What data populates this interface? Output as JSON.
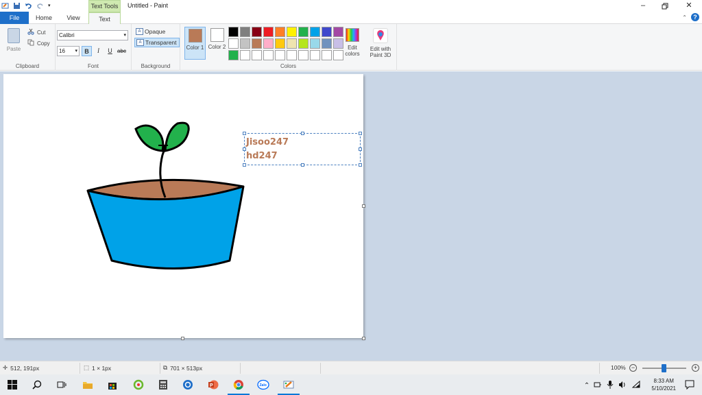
{
  "window": {
    "title": "Untitled - Paint",
    "context_tab": "Text Tools",
    "controls": [
      "minimize-icon",
      "restore-icon",
      "close-icon"
    ]
  },
  "tabs": [
    {
      "label": "File"
    },
    {
      "label": "Home"
    },
    {
      "label": "View"
    },
    {
      "label": "Text"
    }
  ],
  "ribbon": {
    "clipboard": {
      "label": "Clipboard",
      "paste": "Paste",
      "cut": "Cut",
      "copy": "Copy"
    },
    "font": {
      "label": "Font",
      "family": "Calibri",
      "size": "16",
      "bold": "B",
      "italic": "I",
      "underline": "U",
      "strikethrough": "abc"
    },
    "background": {
      "label": "Background",
      "opaque": "Opaque",
      "transparent": "Transparent"
    },
    "colors": {
      "label": "Colors",
      "color1": "Color 1",
      "color2": "Color 2",
      "color1_value": "#b97a57",
      "color2_value": "#ffffff",
      "palette": [
        "#000000",
        "#7f7f7f",
        "#880015",
        "#ed1c24",
        "#ff7f27",
        "#fff200",
        "#22b14c",
        "#00a2e8",
        "#3f48cc",
        "#a349a4",
        "#ffffff",
        "#c3c3c3",
        "#b97a57",
        "#ffaec9",
        "#ffc90e",
        "#efe4b0",
        "#b5e61d",
        "#99d9ea",
        "#7092be",
        "#c8bfe7",
        "#22b14c",
        "#ffffff",
        "#ffffff",
        "#ffffff",
        "#ffffff",
        "#ffffff",
        "#ffffff",
        "#ffffff",
        "#ffffff",
        "#ffffff"
      ],
      "edit_colors": "Edit colors",
      "edit_3d": "Edit with Paint 3D"
    }
  },
  "canvas": {
    "text_lines": [
      "Jisoo247",
      "hd247"
    ],
    "text_color": "#b97a57"
  },
  "status": {
    "cursor_pos": "512, 191px",
    "selection_size": "1 × 1px",
    "canvas_size": "701 × 513px",
    "zoom": "100%"
  },
  "taskbar": {
    "time": "8:33 AM",
    "date": "5/10/2021",
    "apps": [
      "windows-start-icon",
      "search-icon",
      "task-view-icon",
      "file-explorer-icon",
      "store-icon",
      "green-app-icon",
      "calculator-icon",
      "blue-app-icon",
      "powerpoint-icon",
      "chrome-icon",
      "zalo-icon",
      "paint-icon"
    ]
  }
}
